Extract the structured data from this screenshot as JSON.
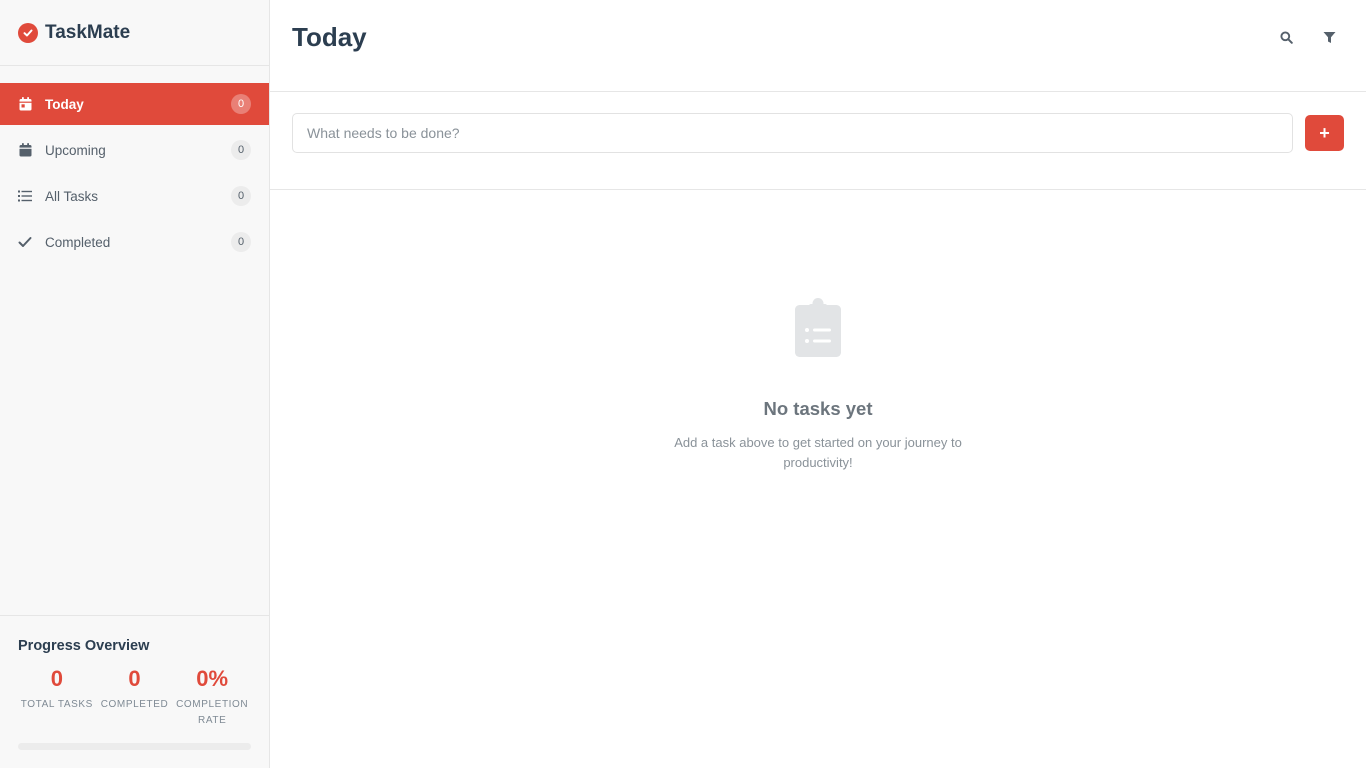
{
  "brand": {
    "name": "TaskMate",
    "icon": "check-circle-icon",
    "accent": "#e04a3b"
  },
  "sidebar": {
    "items": [
      {
        "label": "Today",
        "count": "0",
        "icon": "calendar-day-icon",
        "active": true
      },
      {
        "label": "Upcoming",
        "count": "0",
        "icon": "calendar-icon",
        "active": false
      },
      {
        "label": "All Tasks",
        "count": "0",
        "icon": "list-icon",
        "active": false
      },
      {
        "label": "Completed",
        "count": "0",
        "icon": "check-icon",
        "active": false
      }
    ]
  },
  "progress": {
    "title": "Progress Overview",
    "stats": [
      {
        "value": "0",
        "label": "TOTAL TASKS"
      },
      {
        "value": "0",
        "label": "COMPLETED"
      },
      {
        "value": "0%",
        "label": "COMPLETION RATE"
      }
    ],
    "completion_fraction": 0
  },
  "header": {
    "title": "Today",
    "actions": [
      "search-icon",
      "filter-icon"
    ]
  },
  "add_task": {
    "placeholder": "What needs to be done?",
    "value": "",
    "button_label": "+"
  },
  "empty_state": {
    "icon": "clipboard-list-icon",
    "title": "No tasks yet",
    "text": "Add a task above to get started on your journey to productivity!"
  }
}
